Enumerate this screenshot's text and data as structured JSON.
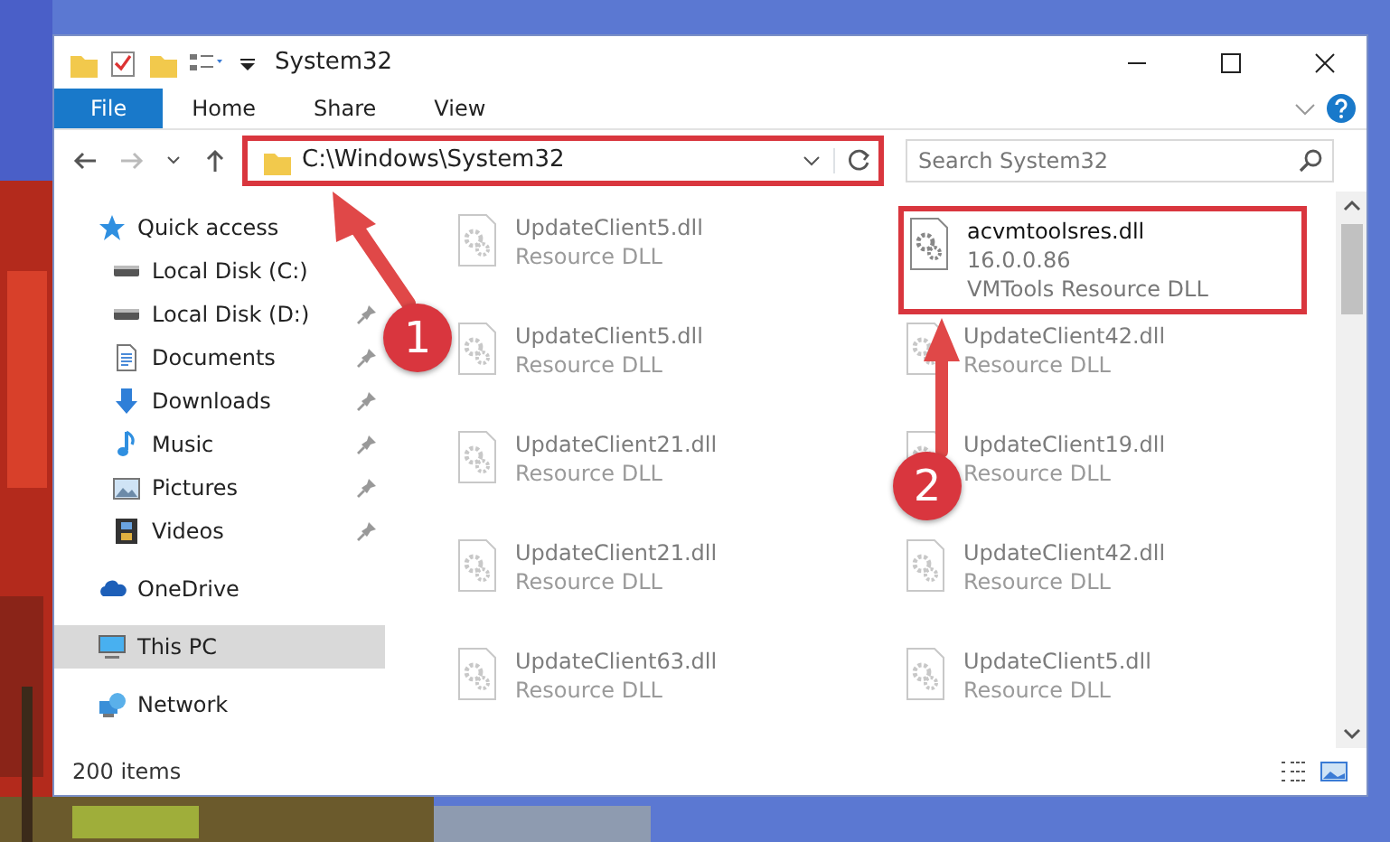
{
  "window": {
    "title": "System32"
  },
  "ribbon": {
    "tabs": [
      {
        "label": "File",
        "kind": "file"
      },
      {
        "label": "Home",
        "kind": "tab"
      },
      {
        "label": "Share",
        "kind": "tab"
      },
      {
        "label": "View",
        "kind": "tab"
      }
    ]
  },
  "address_bar": {
    "path": "C:\\Windows\\System32",
    "highlighted": true
  },
  "search": {
    "placeholder": "Search System32"
  },
  "sidebar": {
    "items": [
      {
        "label": "Quick access",
        "kind": "star",
        "pinned": false,
        "selected": false,
        "children": [
          {
            "label": "Local Disk (C:)",
            "kind": "drive",
            "pinned": false,
            "selected": false
          },
          {
            "label": "Local Disk (D:)",
            "kind": "drive",
            "pinned": true,
            "selected": false
          },
          {
            "label": "Documents",
            "kind": "documents",
            "pinned": true,
            "selected": false
          },
          {
            "label": "Downloads",
            "kind": "downloads",
            "pinned": true,
            "selected": false
          },
          {
            "label": "Music",
            "kind": "music",
            "pinned": true,
            "selected": false
          },
          {
            "label": "Pictures",
            "kind": "pictures",
            "pinned": true,
            "selected": false
          },
          {
            "label": "Videos",
            "kind": "videos",
            "pinned": true,
            "selected": false
          }
        ]
      },
      {
        "label": "OneDrive",
        "kind": "cloud",
        "pinned": false,
        "selected": false
      },
      {
        "label": "This PC",
        "kind": "pc",
        "pinned": false,
        "selected": true
      },
      {
        "label": "Network",
        "kind": "network",
        "pinned": false,
        "selected": false
      }
    ]
  },
  "files": [
    {
      "name": "UpdateClient5.dll",
      "type": "Resource DLL",
      "highlighted": false
    },
    {
      "name": "acvmtoolsres.dll",
      "version": "16.0.0.86",
      "type": "VMTools Resource DLL",
      "highlighted": true
    },
    {
      "name": "UpdateClient5.dll",
      "type": "Resource DLL",
      "highlighted": false
    },
    {
      "name": "UpdateClient42.dll",
      "type": "Resource DLL",
      "highlighted": false
    },
    {
      "name": "UpdateClient21.dll",
      "type": "Resource DLL",
      "highlighted": false
    },
    {
      "name": "UpdateClient19.dll",
      "type": "Resource DLL",
      "highlighted": false
    },
    {
      "name": "UpdateClient21.dll",
      "type": "Resource DLL",
      "highlighted": false
    },
    {
      "name": "UpdateClient42.dll",
      "type": "Resource DLL",
      "highlighted": false
    },
    {
      "name": "UpdateClient63.dll",
      "type": "Resource DLL",
      "highlighted": false
    },
    {
      "name": "UpdateClient5.dll",
      "type": "Resource DLL",
      "highlighted": false
    }
  ],
  "status_bar": {
    "count": "200 items"
  },
  "annotations": [
    {
      "label": "1"
    },
    {
      "label": "2"
    }
  ]
}
